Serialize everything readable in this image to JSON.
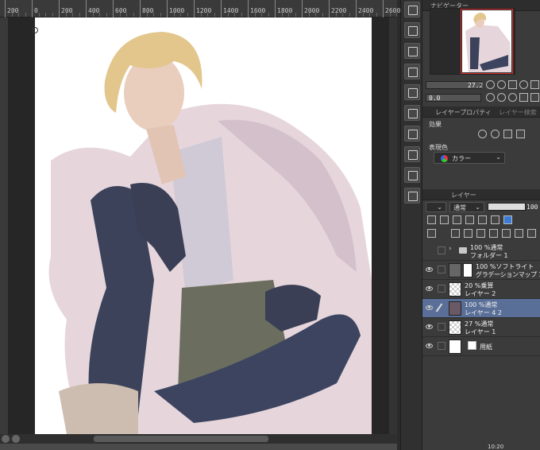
{
  "ruler": {
    "labels": [
      "200",
      "0",
      "200",
      "400",
      "600",
      "800",
      "1000",
      "1200",
      "1400",
      "1600",
      "1800",
      "2000",
      "2200",
      "2400",
      "2600"
    ]
  },
  "panels": {
    "navigator_tab": "ナビゲーター",
    "zoom_value": "27.2",
    "rotate_value": "0.0",
    "layer_property_tab": "レイヤープロパティ",
    "layer_search_tab": "レイヤー検索",
    "effect_label": "効果",
    "expression_color_label": "表現色",
    "expression_color_value": "カラー",
    "layer_tab": "レイヤー",
    "blend_mode": "通常",
    "opacity_value": "100"
  },
  "layers": [
    {
      "line1": "100 %通常",
      "line2": "フォルダー 1",
      "kind": "folder"
    },
    {
      "line1": "100 %ソフトライト",
      "line2": "グラデーションマップ 1",
      "kind": "gradient"
    },
    {
      "line1": "20 %乗算",
      "line2": "レイヤー 2",
      "kind": "raster"
    },
    {
      "line1": "100 %通常",
      "line2": "レイヤー 4 2",
      "kind": "raster",
      "selected": true
    },
    {
      "line1": "27 %通常",
      "line2": "レイヤー 1",
      "kind": "raster"
    },
    {
      "line1": "",
      "line2": "用紙",
      "kind": "paper"
    }
  ],
  "clock": "10:20",
  "colors": {
    "selected_row": "#5a6f98",
    "nav_frame": "#e03030",
    "accent_blue": "#3a7bd5"
  }
}
